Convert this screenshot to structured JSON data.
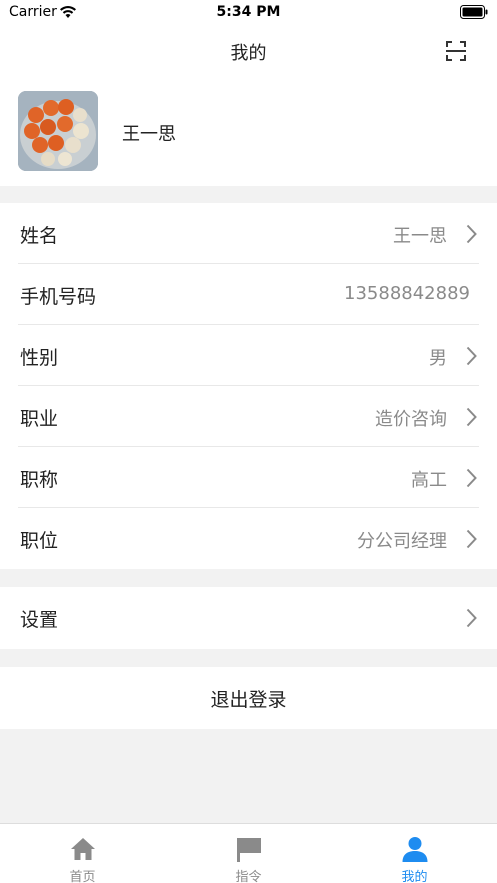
{
  "status_bar": {
    "carrier": "Carrier",
    "time": "5:34 PM"
  },
  "nav": {
    "title": "我的",
    "scan_icon": "scan-icon"
  },
  "profile": {
    "name": "王一思"
  },
  "info_rows": [
    {
      "label": "姓名",
      "value": "王一思",
      "arrow": true
    },
    {
      "label": "手机号码",
      "value": "13588842889",
      "arrow": false
    },
    {
      "label": "性别",
      "value": "男",
      "arrow": true
    },
    {
      "label": "职业",
      "value": "造价咨询",
      "arrow": true
    },
    {
      "label": "职称",
      "value": "高工",
      "arrow": true
    },
    {
      "label": "职位",
      "value": "分公司经理",
      "arrow": true
    }
  ],
  "settings": {
    "label": "设置"
  },
  "logout": {
    "label": "退出登录"
  },
  "tabs": [
    {
      "label": "首页",
      "icon": "home-icon",
      "active": false
    },
    {
      "label": "指令",
      "icon": "flag-icon",
      "active": false
    },
    {
      "label": "我的",
      "icon": "person-icon",
      "active": true
    }
  ],
  "colors": {
    "accent": "#1e8cf0",
    "background": "#f2f2f2",
    "value_text": "#8a8a8a"
  }
}
